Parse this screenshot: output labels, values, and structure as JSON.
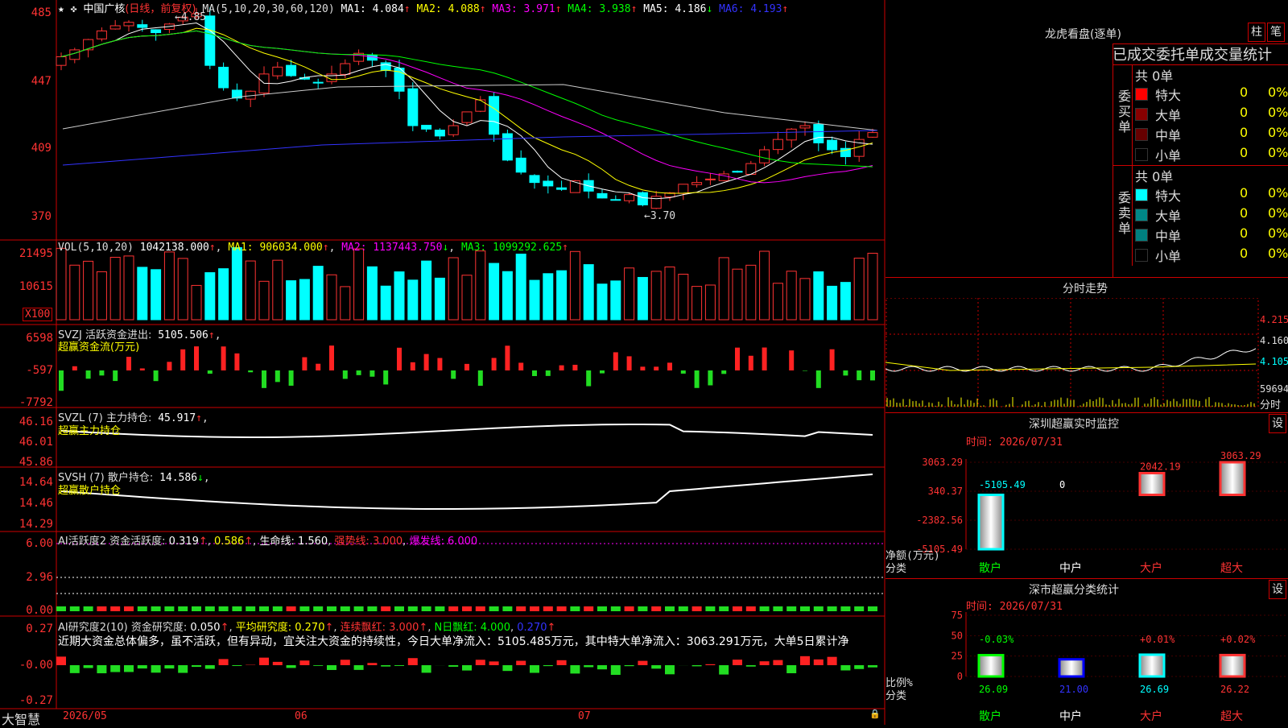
{
  "app": {
    "brand": "大智慧"
  },
  "stock": {
    "name": "中国广核",
    "period": "(日线，前复权)"
  },
  "main": {
    "ma_header": "MA(5,10,20,30,60,120)",
    "ma": [
      {
        "label": "MA1:",
        "value": "4.084",
        "arrow": "↑",
        "color": "#ffffff"
      },
      {
        "label": "MA2:",
        "value": "4.088",
        "arrow": "↑",
        "color": "#ffff00"
      },
      {
        "label": "MA3:",
        "value": "3.971",
        "arrow": "↑",
        "color": "#ff00ff"
      },
      {
        "label": "MA4:",
        "value": "3.938",
        "arrow": "↑",
        "color": "#00ff00"
      },
      {
        "label": "MA5:",
        "value": "4.186",
        "arrow": "↓",
        "color": "#ffffff"
      },
      {
        "label": "MA6:",
        "value": "4.193",
        "arrow": "↑",
        "color": "#3333ff"
      }
    ],
    "y_ticks": [
      "485",
      "447",
      "409",
      "370"
    ],
    "high_label": "4.85",
    "low_label": "3.70",
    "colors": {
      "up": "#ff3333",
      "down": "#00ffff"
    }
  },
  "vol": {
    "header": "VOL(5,10,20)",
    "value": "1042138.000",
    "ma1": "MA1: 906034.000",
    "ma2": "MA2: 1137443.750",
    "ma3": "MA3: 1099292.625",
    "y_ticks": [
      "21495",
      "10615"
    ],
    "unit": "X100"
  },
  "svzj": {
    "header": "SVZJ  活跃资金进出:",
    "value": "5105.506",
    "sub": "超赢资金流(万元)",
    "y_ticks": [
      "6598",
      "-597",
      "-7792"
    ]
  },
  "svzl": {
    "header": "SVZL (7) 主力持仓:",
    "value": "45.917",
    "sub": "超赢主力持仓",
    "y_ticks": [
      "46.16",
      "46.01",
      "45.86"
    ]
  },
  "svsh": {
    "header": "SVSH (7) 散户持仓:",
    "value": "14.586",
    "sub": "超赢散户持仓",
    "y_ticks": [
      "14.64",
      "14.46",
      "14.29"
    ]
  },
  "ai1": {
    "header": "AI活跃度2 资金活跃度:",
    "v1": "0.319",
    "v2": "0.586",
    "life": "生命线: 1.560",
    "strong": "强势线: 3.000",
    "burst": "爆发线: 6.000",
    "y_ticks": [
      "6.00",
      "2.96",
      "0.00"
    ]
  },
  "ai2": {
    "header": "AI研究度2(10) 资金研究度:",
    "v1": "0.050",
    "avg": "平均研究度: 0.270",
    "cont": "连续飘红: 3.000",
    "nday": "N日飘红: 4.000",
    "v4": "0.270",
    "text": "近期大资金总体偏多，虽不活跃，但有异动，宜关注大资金的持续性，今日大单净流入：5105.485万元，其中特大单净流入：3063.291万元，大单5日累计净",
    "y_ticks": [
      "0.27",
      "-0.00",
      "-0.27"
    ]
  },
  "xaxis": {
    "labels": [
      "2026/05",
      "06",
      "07"
    ]
  },
  "right": {
    "lhb": {
      "title": "龙虎看盘(逐单)",
      "btn1": "柱",
      "btn2": "笔",
      "subtitle": "已成交委托单成交量统计",
      "buy": {
        "side": "委买单",
        "total": "共 0单",
        "rows": [
          {
            "label": "特大",
            "count": "0",
            "pct": "0%",
            "color": "#ff0000"
          },
          {
            "label": "大单",
            "count": "0",
            "pct": "0%",
            "color": "#880000"
          },
          {
            "label": "中单",
            "count": "0",
            "pct": "0%",
            "color": "#660000"
          },
          {
            "label": "小单",
            "count": "0",
            "pct": "0%",
            "color": "#000000"
          }
        ]
      },
      "sell": {
        "side": "委卖单",
        "total": "共 0单",
        "rows": [
          {
            "label": "特大",
            "count": "0",
            "pct": "0%",
            "color": "#00ffff"
          },
          {
            "label": "大单",
            "count": "0",
            "pct": "0%",
            "color": "#008888"
          },
          {
            "label": "中单",
            "count": "0",
            "pct": "0%",
            "color": "#008080"
          },
          {
            "label": "小单",
            "count": "0",
            "pct": "0%",
            "color": "#000000"
          }
        ]
      }
    },
    "fenshi": {
      "title": "分时走势",
      "prices": [
        "4.215",
        "4.160",
        "4.105"
      ],
      "vol": "59694",
      "sub": "分时"
    },
    "sz_monitor": {
      "title": "深圳超赢实时监控",
      "btn": "设",
      "time": "时间: 2026/07/31",
      "y_ticks": [
        "3063.29",
        "340.37",
        "-2382.56",
        "-5105.49"
      ],
      "unit": "净额(万元)",
      "cat": "分类",
      "cats": [
        "散户",
        "中户",
        "大户",
        "超大"
      ],
      "values": [
        -5105.49,
        0,
        2042.19,
        3063.29
      ],
      "value_labels": [
        "-5105.49",
        "0",
        "2042.19",
        "3063.29"
      ]
    },
    "sz_class": {
      "title": "深市超赢分类统计",
      "btn": "设",
      "time": "时间: 2026/07/31",
      "y_ticks": [
        "75",
        "50",
        "25",
        "0"
      ],
      "unit": "比例%",
      "cat": "分类",
      "cats": [
        "散户",
        "中户",
        "大户",
        "超大"
      ],
      "values": [
        26.09,
        21.0,
        26.69,
        26.22
      ],
      "value_labels": [
        "26.09",
        "21.00",
        "26.69",
        "26.22"
      ],
      "change_labels": [
        "-0.03%",
        "",
        "+0.01%",
        "+0.02%"
      ]
    }
  }
}
